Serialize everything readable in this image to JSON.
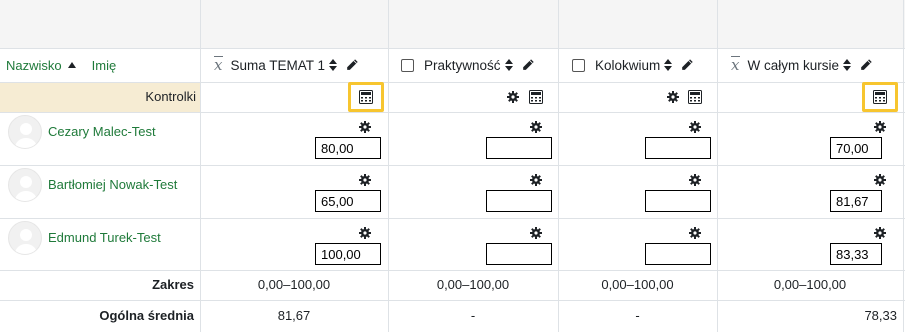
{
  "header": {
    "surname_link": "Nazwisko",
    "firstname_link": "Imię",
    "columns": [
      {
        "label": "Suma TEMAT 1",
        "kind": "aggregate"
      },
      {
        "label": "Praktywność",
        "kind": "checkbox"
      },
      {
        "label": "Kolokwium",
        "kind": "checkbox"
      },
      {
        "label": "W całym kursie",
        "kind": "aggregate"
      }
    ]
  },
  "controls_label": "Kontrolki",
  "students": [
    {
      "name": "Cezary Malec-Test",
      "grades": [
        "80,00",
        "",
        "",
        "70,00"
      ]
    },
    {
      "name": "Bartłomiej Nowak-Test",
      "grades": [
        "65,00",
        "",
        "",
        "81,67"
      ]
    },
    {
      "name": "Edmund Turek-Test",
      "grades": [
        "100,00",
        "",
        "",
        "83,33"
      ]
    }
  ],
  "range": {
    "label": "Zakres",
    "values": [
      "0,00–100,00",
      "0,00–100,00",
      "0,00–100,00",
      "0,00–100,00"
    ]
  },
  "average": {
    "label": "Ogólna średnia",
    "values": [
      "81,67",
      "-",
      "-",
      "78,33"
    ]
  },
  "colors": {
    "link": "#1f7a3a",
    "highlight": "#f7c52f",
    "controls_bg": "#f6ecd3"
  },
  "icons": [
    "sort-icon",
    "pencil-icon",
    "gear-icon",
    "calculator-icon",
    "checkbox-icon",
    "avatar-icon"
  ]
}
